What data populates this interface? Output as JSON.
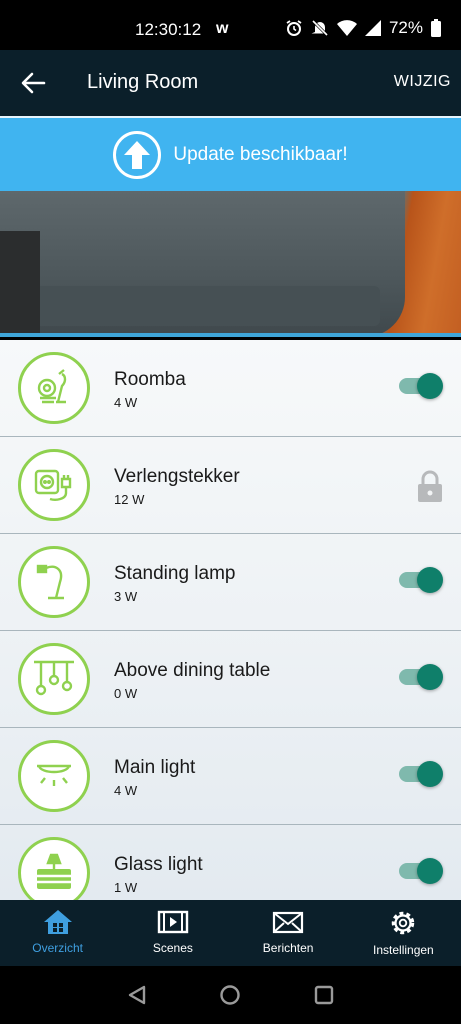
{
  "status_bar": {
    "time": "12:30:12",
    "app_indicator": "w",
    "battery": "72%",
    "icons": [
      "alarm-icon",
      "do-not-disturb-icon",
      "wifi-icon",
      "signal-icon",
      "battery-icon"
    ]
  },
  "app_bar": {
    "title": "Living Room",
    "action": "WIJZIG"
  },
  "update_banner": {
    "label": "Update beschikbaar!",
    "color": "#40b4f0"
  },
  "devices": [
    {
      "name": "Roomba",
      "power": "4 W",
      "icon": "vacuum-robot-icon",
      "control": "toggle",
      "on": true
    },
    {
      "name": "Verlengstekker",
      "power": "12 W",
      "icon": "power-strip-icon",
      "control": "lock",
      "on": false
    },
    {
      "name": "Standing lamp",
      "power": "3 W",
      "icon": "floor-lamp-icon",
      "control": "toggle",
      "on": true
    },
    {
      "name": "Above dining table",
      "power": "0 W",
      "icon": "pendant-lights-icon",
      "control": "toggle",
      "on": true
    },
    {
      "name": "Main light",
      "power": "4 W",
      "icon": "ceiling-light-icon",
      "control": "toggle",
      "on": true
    },
    {
      "name": "Glass light",
      "power": "1 W",
      "icon": "table-lamp-icon",
      "control": "toggle",
      "on": true
    }
  ],
  "tabs": [
    {
      "label": "Overzicht",
      "icon": "home-icon",
      "active": true
    },
    {
      "label": "Scenes",
      "icon": "film-icon",
      "active": false
    },
    {
      "label": "Berichten",
      "icon": "envelope-icon",
      "active": false
    },
    {
      "label": "Instellingen",
      "icon": "gear-icon",
      "active": false
    }
  ],
  "colors": {
    "header": "#0b1f2a",
    "accent_green": "#8fd14f",
    "toggle_on": "#0f7f6a",
    "tab_active": "#3f9fe0"
  }
}
